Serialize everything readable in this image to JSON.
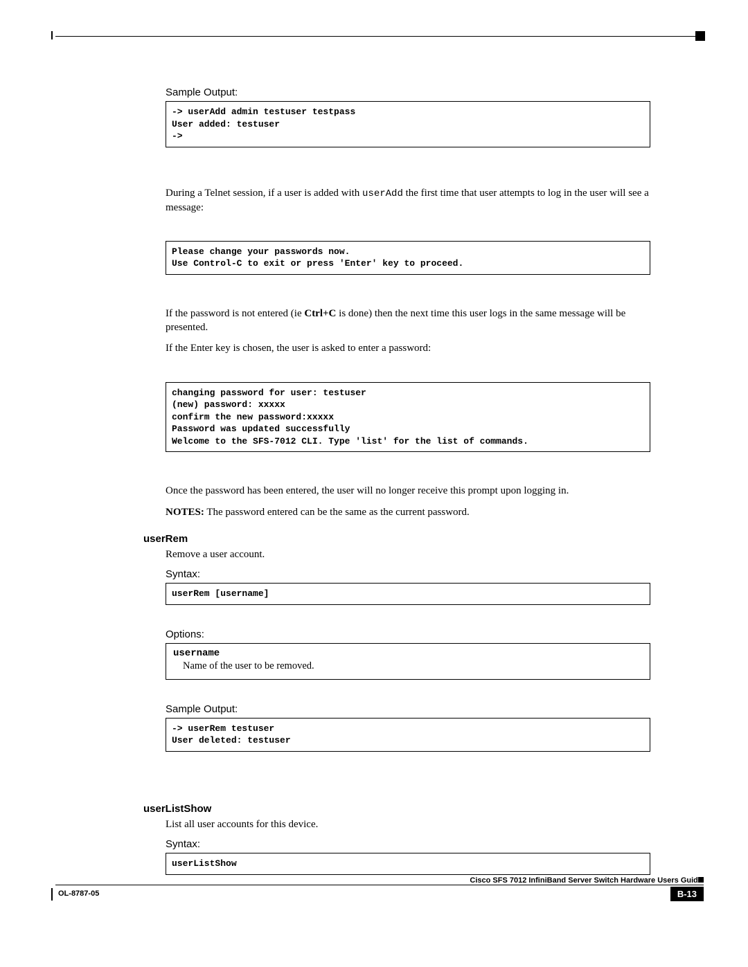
{
  "labels": {
    "sampleOutput1": "Sample Output:",
    "syntax1": "Syntax:",
    "options1": "Options:",
    "sampleOutput2": "Sample Output:",
    "syntax2": "Syntax:"
  },
  "code": {
    "block1": "-> userAdd admin testuser testpass\nUser added: testuser\n->",
    "block2": "Please change your passwords now.\nUse Control-C to exit or press 'Enter' key to proceed.",
    "block3": "changing password for user: testuser\n(new) password: xxxxx\nconfirm the new password:xxxxx\nPassword was updated successfully\nWelcome to the SFS-7012 CLI. Type 'list' for the list of commands.",
    "userRemSyntax": "userRem [username]",
    "userRemSample": "-> userRem testuser\nUser deleted: testuser",
    "userListShowSyntax": "userListShow"
  },
  "text": {
    "p1a": "During a Telnet session, if a user is added with ",
    "p1code": "userAdd",
    "p1b": " the first time that user attempts to log in the user will see a message:",
    "p2a": "If the password is not entered (ie ",
    "p2bold": "Ctrl+C",
    "p2b": " is done) then the next time this user logs in the same message will be presented.",
    "p3": "If the Enter key is chosen, the user is asked to enter a password:",
    "p4": "Once the password has been entered, the user will no longer receive this prompt upon logging in.",
    "p5bold": "NOTES:",
    "p5rest": " The password entered can be the same as the current password.",
    "userRemDesc": "Remove a user account.",
    "optName": "username",
    "optDesc": "Name of the user to be removed.",
    "userListDesc": "List all user accounts for this device."
  },
  "headings": {
    "userRem": "userRem",
    "userListShow": "userListShow"
  },
  "footer": {
    "guide": "Cisco SFS 7012 InfiniBand Server Switch Hardware Users Guide",
    "docnum": "OL-8787-05",
    "pagenum": "B-13"
  }
}
